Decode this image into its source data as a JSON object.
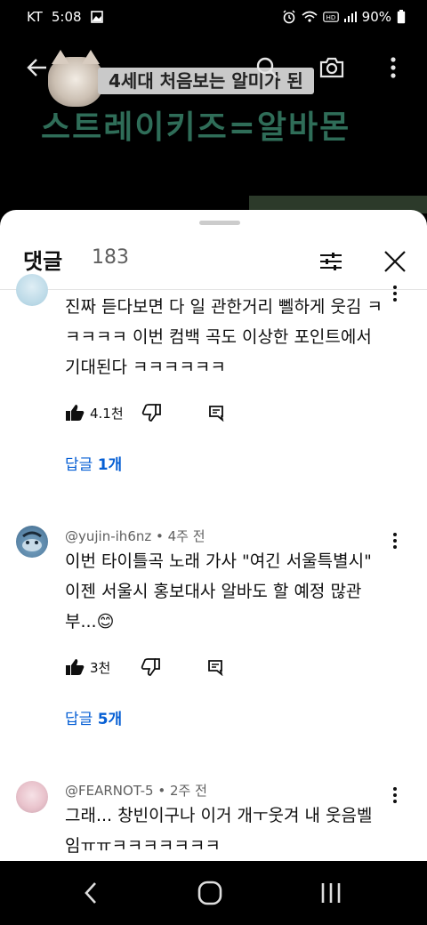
{
  "status_bar": {
    "carrier": "KT",
    "time": "5:08",
    "battery": "90%"
  },
  "video": {
    "overlay_title": "4세대 처음보는 알미가 된",
    "headline": "스트레이키즈=알바몬"
  },
  "comments_panel": {
    "title": "댓글",
    "count": "183"
  },
  "comments": [
    {
      "text": "진짜 듣다보면 다 일 관한거리 뻴하게 웃김 ㅋㅋㅋㅋㅋ 이번 컴백 곡도 이상한 포인트에서 기대된다 ㅋㅋㅋㅋㅋㅋ",
      "likes": "4.1천",
      "reply_prefix": "답글 ",
      "reply_count": "1개"
    },
    {
      "author": "@yujin-ih6nz",
      "time": "4주 전",
      "text": "이번 타이틀곡 노래 가사 \"여긴 서울특별시\" 이젠 서울시 홍보대사 알바도 할 예정 많관부...😊",
      "likes": "3천",
      "reply_prefix": "답글 ",
      "reply_count": "5개"
    },
    {
      "author": "@FEARNOT-5",
      "time": "2주 전",
      "text": "그래... 창빈이구나  이거 개ㅜ웃겨 내 웃음벨임ㅠㅠㅋㅋㅋㅋㅋㅋㅋ"
    }
  ],
  "meta_separator": " • ",
  "colors": {
    "link": "#065fd4",
    "headline": "#2f6d58"
  }
}
